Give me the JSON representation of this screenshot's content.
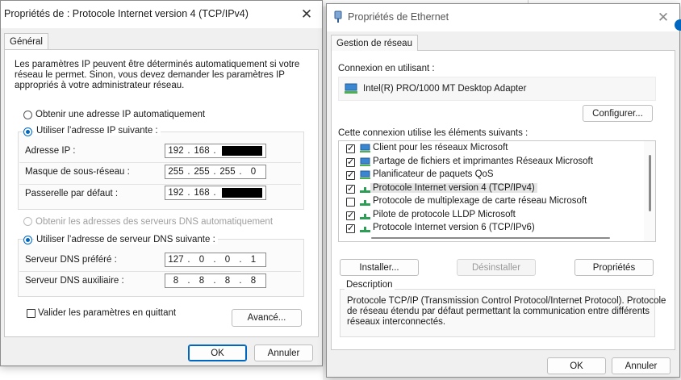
{
  "left_dialog": {
    "title": "Propriétés de : Protocole Internet version 4 (TCP/IPv4)",
    "tab": "Général",
    "intro": [
      "Les paramètres IP peuvent être déterminés automatiquement si votre",
      "réseau le permet. Sinon, vous devez demander les paramètres IP",
      "appropriés à votre administrateur réseau."
    ],
    "radio_auto_ip": "Obtenir une adresse IP automatiquement",
    "radio_manual_ip": "Utiliser l’adresse IP suivante :",
    "ip_label": "Adresse IP :",
    "ip": [
      "192",
      "168"
    ],
    "mask_label": "Masque de sous-réseau :",
    "mask": [
      "255",
      "255",
      "255",
      "0"
    ],
    "gateway_label": "Passerelle par défaut :",
    "gateway": [
      "192",
      "168"
    ],
    "radio_auto_dns": "Obtenir les adresses des serveurs DNS automatiquement",
    "radio_manual_dns": "Utiliser l’adresse de serveur DNS suivante :",
    "dns1_label": "Serveur DNS préféré :",
    "dns1": [
      "127",
      "0",
      "0",
      "1"
    ],
    "dns2_label": "Serveur DNS auxiliaire :",
    "dns2": [
      "8",
      "8",
      "8",
      "8"
    ],
    "validate_label": "Valider les paramètres en quittant",
    "advanced_button": "Avancé...",
    "ok_button": "OK",
    "cancel_button": "Annuler"
  },
  "right_dialog": {
    "title": "Propriétés de Ethernet",
    "tab": "Gestion de réseau",
    "connect_label": "Connexion en utilisant :",
    "adapter": "Intel(R) PRO/1000 MT Desktop Adapter",
    "configure_button": "Configurer...",
    "items_label": "Cette connexion utilise les éléments suivants :",
    "items": [
      {
        "label": "Client pour les réseaux Microsoft",
        "checked": true,
        "icon": "client-icon"
      },
      {
        "label": "Partage de fichiers et imprimantes Réseaux Microsoft",
        "checked": true,
        "icon": "service-icon"
      },
      {
        "label": "Planificateur de paquets QoS",
        "checked": true,
        "icon": "service-icon"
      },
      {
        "label": "Protocole Internet version 4 (TCP/IPv4)",
        "checked": true,
        "icon": "protocol-icon",
        "selected": true
      },
      {
        "label": "Protocole de multiplexage de carte réseau Microsoft",
        "checked": false,
        "icon": "protocol-icon"
      },
      {
        "label": "Pilote de protocole LLDP Microsoft",
        "checked": true,
        "icon": "protocol-icon"
      },
      {
        "label": "Protocole Internet version 6 (TCP/IPv6)",
        "checked": true,
        "icon": "protocol-icon"
      }
    ],
    "install_button": "Installer...",
    "uninstall_button": "Désinstaller",
    "properties_button": "Propriétés",
    "description_title": "Description",
    "description": [
      "Protocole TCP/IP (Transmission Control Protocol/Internet Protocol). Protocole",
      "de réseau étendu par défaut permettant la communication entre différents",
      "réseaux interconnectés."
    ],
    "ok_button": "OK",
    "cancel_button": "Annuler"
  },
  "colors": {
    "accent": "#0067c0",
    "window_bg": "#f0f0f0",
    "panel_bg": "#ffffff"
  }
}
